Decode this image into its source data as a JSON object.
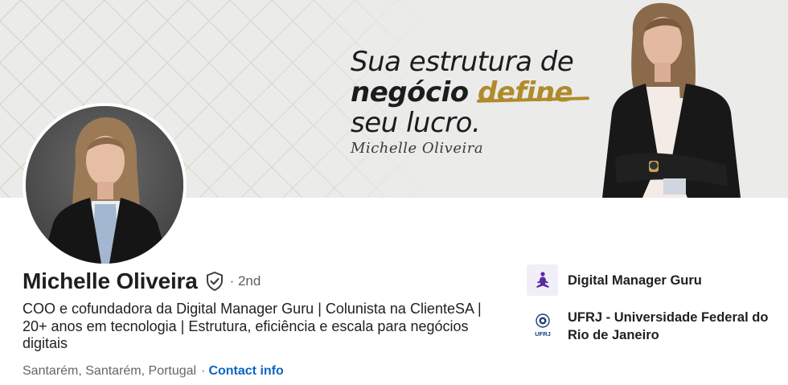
{
  "banner": {
    "line1": "Sua estrutura de",
    "line2_a": "negócio ",
    "line2_b": "define",
    "line3": "seu lucro.",
    "signature": "Michelle Oliveira",
    "accent_color": "#b08b2c"
  },
  "profile": {
    "name": "Michelle Oliveira",
    "degree": "· 2nd",
    "headline": "COO e cofundadora da Digital Manager Guru | Colunista na ClienteSA | 20+ anos em tecnologia | Estrutura, eficiência e escala para negócios digitais",
    "location": "Santarém, Santarém, Portugal",
    "separator": "·",
    "contact_label": "Contact info",
    "link_color": "#0a66c2"
  },
  "organizations": [
    {
      "name": "Digital Manager Guru",
      "logo_icon": "guru-meditation-icon"
    },
    {
      "name": "UFRJ - Universidade Federal do Rio de Janeiro",
      "logo_icon": "ufrj-logo-icon",
      "logo_text": "UFRJ"
    }
  ]
}
